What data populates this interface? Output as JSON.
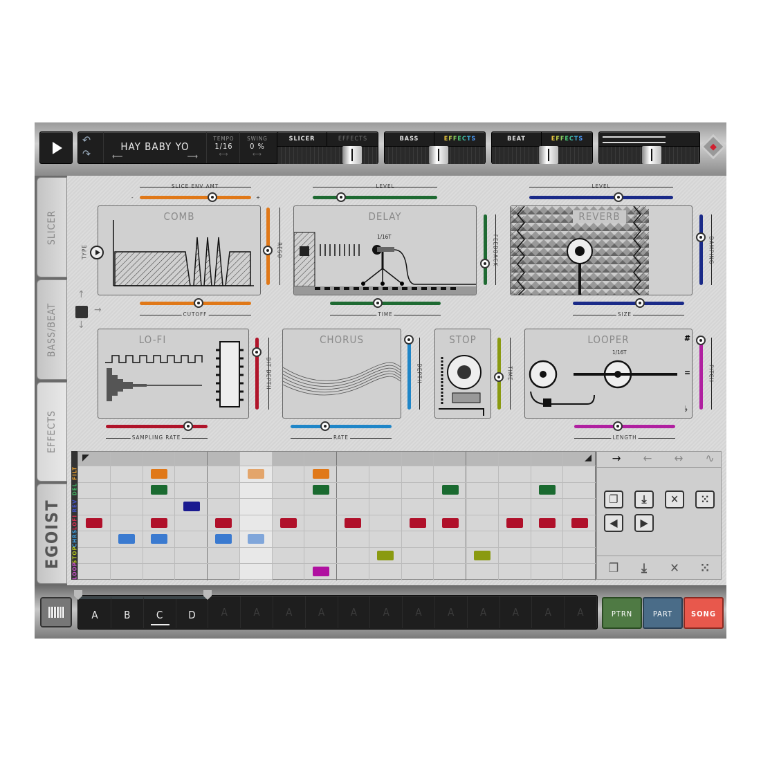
{
  "transport": {
    "play_icon": "play-icon",
    "song_name": "HAY BABY YO",
    "tempo_label": "TEMPO",
    "tempo_value": "1/16",
    "swing_label": "SWING",
    "swing_value": "0 %"
  },
  "mixer": [
    {
      "label": "SLICER",
      "effects_label": "EFFECTS",
      "effects_active": false,
      "level": 0.8
    },
    {
      "label": "BASS",
      "effects_label": "EFFECTS",
      "effects_active": true,
      "level": 0.55
    },
    {
      "label": "BEAT",
      "effects_label": "EFFECTS",
      "effects_active": true,
      "level": 0.58
    }
  ],
  "master": {
    "level": 0.53,
    "meter_left": 0.7,
    "meter_right": 0.7
  },
  "sidebar": {
    "tabs": [
      {
        "label": "SLICER"
      },
      {
        "label": "BASS/BEAT"
      },
      {
        "label": "EFFECTS",
        "active": true
      }
    ],
    "logo": "EGOIST"
  },
  "effects": {
    "comb": {
      "title": "COMB",
      "type_label": "TYPE",
      "slice_env_label": "SLICE ENV AMT",
      "slice_env": 0.65,
      "minus": "-",
      "plus": "+",
      "reso_label": "RESO",
      "reso": 0.45,
      "cutoff_label": "CUTOFF",
      "cutoff": 0.53,
      "color": "#e07818"
    },
    "delay": {
      "title": "DELAY",
      "level_label": "LEVEL",
      "level": 0.23,
      "feedback_label": "FEEDBACK",
      "feedback": 0.3,
      "time_label": "TIME",
      "time": 0.43,
      "rate_text": "1/16T",
      "color": "#1e6a32"
    },
    "reverb": {
      "title": "REVERB",
      "level_label": "LEVEL",
      "level": 0.62,
      "damping_label": "DAMPING",
      "damping": 0.68,
      "size_label": "SIZE",
      "size": 0.6,
      "color": "#1a2a88"
    },
    "lofi": {
      "title": "LO-FI",
      "bit_depth_label": "BIT DEPTH",
      "bit_depth": 0.8,
      "sampling_rate_label": "SAMPLING RATE",
      "sampling_rate": 0.81,
      "color": "#b0142a"
    },
    "chorus": {
      "title": "CHORUS",
      "depth_label": "DEPTH",
      "depth": 0.97,
      "rate_label": "RATE",
      "rate": 0.34,
      "color": "#1f86c8"
    },
    "stop": {
      "title": "STOP",
      "time_label": "TIME",
      "time": 0.45,
      "color": "#8a9a10"
    },
    "looper": {
      "title": "LOOPER",
      "rate_text": "1/16T",
      "pitch_label": "PITCH",
      "pitch": 0.96,
      "length_label": "LENGTH",
      "length": 0.43,
      "sharp": "#",
      "natural": "=",
      "flat": "♭",
      "color": "#b020a0"
    }
  },
  "sequencer": {
    "steps": 16,
    "playhead_step": 5,
    "rows": [
      {
        "label": "FILT",
        "color": "#e07818",
        "label_color": "#e8a030",
        "active": [
          2,
          5,
          7
        ]
      },
      {
        "label": "DEL",
        "color": "#1a6a30",
        "label_color": "#40b060",
        "active": [
          2,
          7,
          11,
          14
        ]
      },
      {
        "label": "REV",
        "color": "#1a1a90",
        "label_color": "#4050c0",
        "active": [
          3
        ]
      },
      {
        "label": "LOFI",
        "color": "#b0102a",
        "label_color": "#d03050",
        "active": [
          0,
          2,
          4,
          6,
          8,
          10,
          11,
          13,
          14,
          15
        ]
      },
      {
        "label": "CHRS",
        "color": "#3a7ad0",
        "label_color": "#40a0e0",
        "active": [
          1,
          2,
          4,
          5
        ]
      },
      {
        "label": "STOP",
        "color": "#8a9a10",
        "label_color": "#b0c020",
        "active": [
          9,
          12
        ]
      },
      {
        "label": "LOOP",
        "color": "#b010a0",
        "label_color": "#c050c0",
        "active": [
          7
        ]
      }
    ],
    "direction_icons": [
      "arrow-right-icon",
      "arrow-left-icon",
      "arrow-both-icon",
      "random-direction-icon"
    ],
    "direction_glyphs": [
      "→",
      "←",
      "↔",
      "∿"
    ]
  },
  "patterns": {
    "slots": [
      "A",
      "B",
      "C",
      "D",
      "A",
      "A",
      "A",
      "A",
      "A",
      "A",
      "A",
      "A",
      "A",
      "A",
      "A",
      "A"
    ],
    "selected": "C",
    "active_count": 4
  },
  "modes": {
    "ptrn": "PTRN",
    "part": "PART",
    "song": "SONG"
  }
}
